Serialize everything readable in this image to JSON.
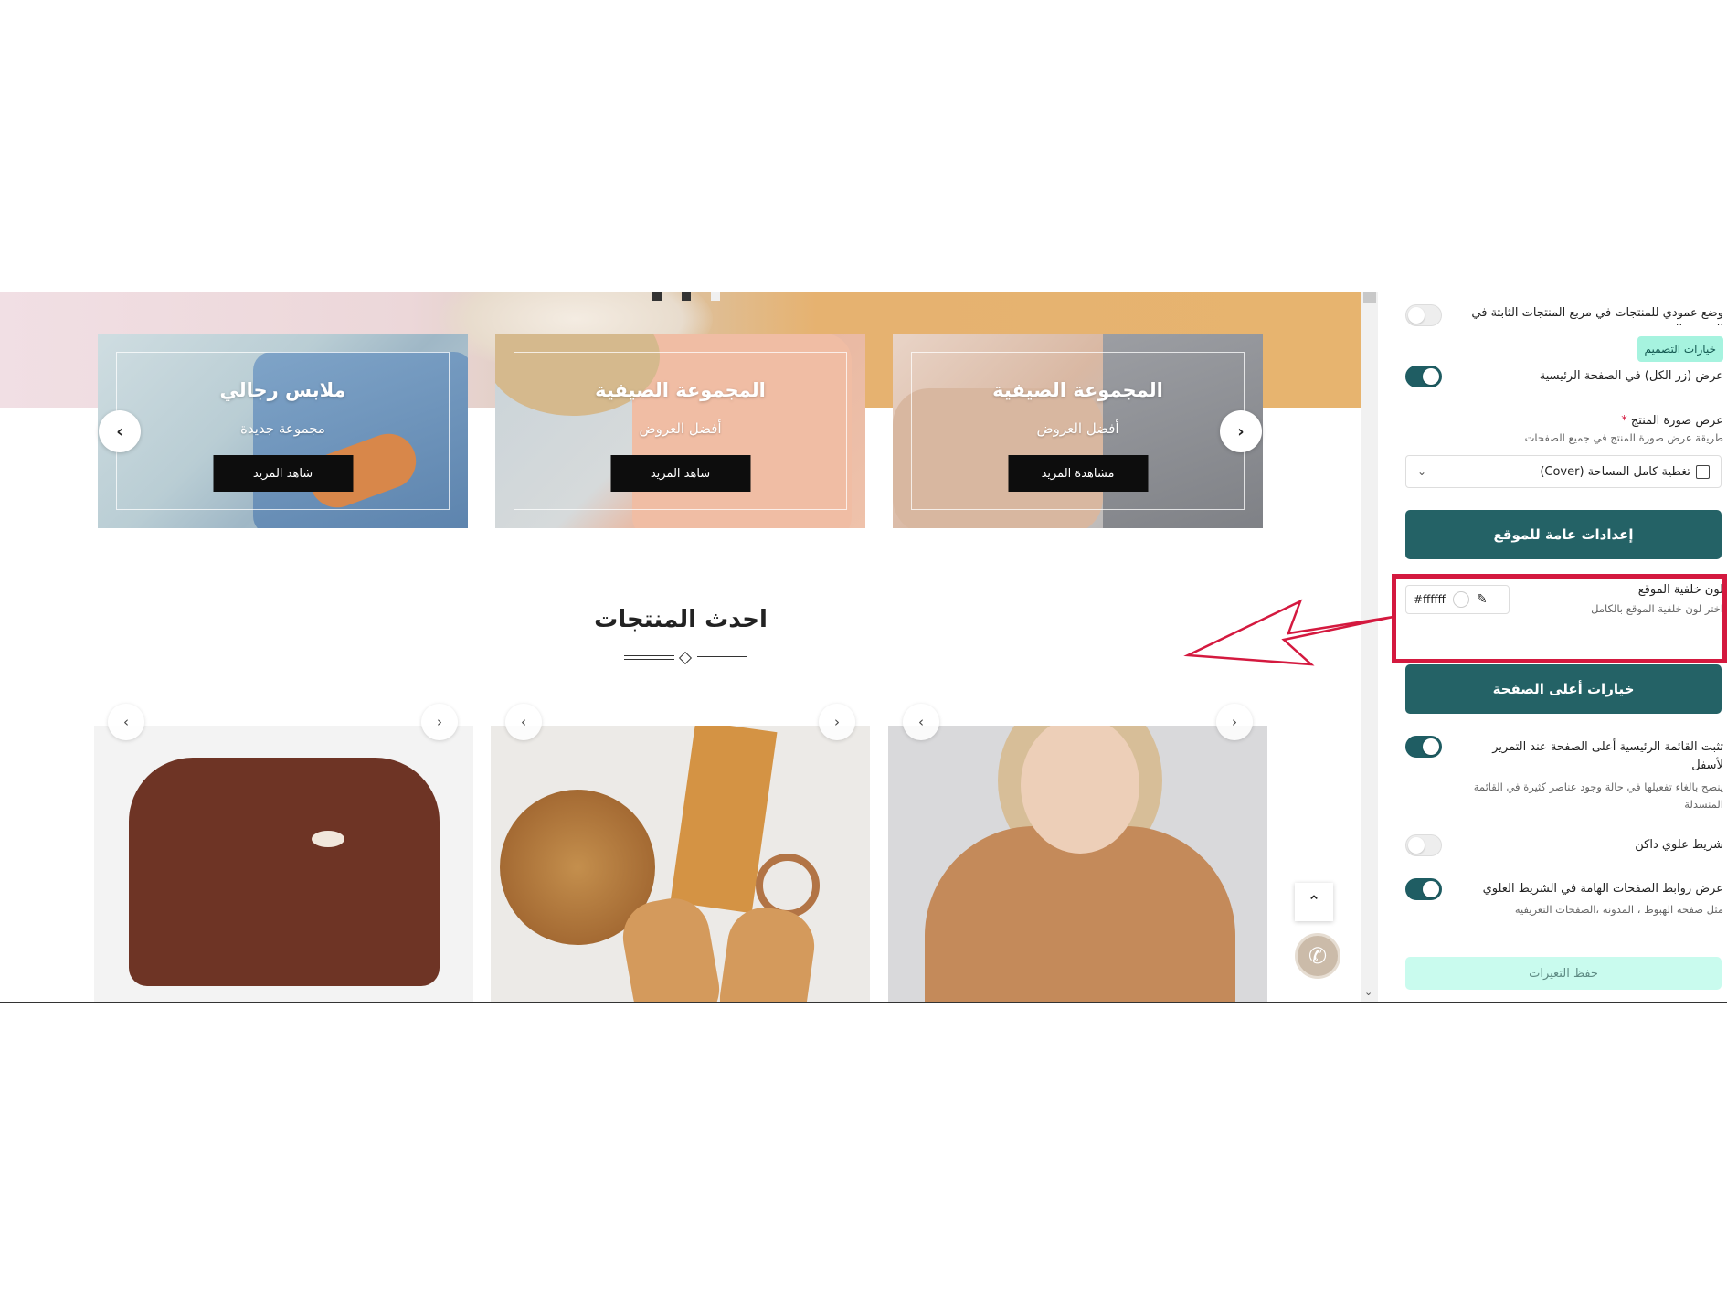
{
  "preview": {
    "banners": [
      {
        "title": "ملابس رجالي",
        "subtitle": "مجموعة جديدة",
        "button": "شاهد المزيد"
      },
      {
        "title": "المجموعة الصيفية",
        "subtitle": "أفضل العروض",
        "button": "شاهد المزيد"
      },
      {
        "title": "المجموعة الصيفية",
        "subtitle": "أفضل العروض",
        "button": "مشاهدة المزيد"
      }
    ],
    "section_title": "احدث المنتجات"
  },
  "panel": {
    "vertical_mode_label": "وضع عمودي للمنتجات في مربع المنتجات الثابتة في الصفحة الرئيسية",
    "design_options_chip": "خيارات التصميم",
    "show_all_button_label": "عرض (زر الكل) في الصفحة الرئيسية",
    "product_image_label": "عرض صورة المنتج",
    "required_mark": "*",
    "product_image_desc": "طريقة عرض صورة المنتج في جميع الصفحات",
    "product_image_value": "تغطية كامل المساحة (Cover)",
    "general_settings_button": "إعدادات عامة للموقع",
    "bg_color_label": "لون خلفية الموقع",
    "bg_color_desc": "اختر لون خلفية الموقع بالكامل",
    "bg_color_value": "#ffffff",
    "header_options_button": "خيارات أعلى الصفحة",
    "sticky_menu_label": "تثبت القائمة الرئيسية أعلى الصفحة عند التمرير لأسفل",
    "sticky_menu_desc": "ينصح بالغاء تفعيلها في حالة وجود عناصر كثيرة في القائمة المنسدلة",
    "dark_topbar_label": "شريط علوي داكن",
    "important_links_label": "عرض روابط الصفحات الهامة في الشريط العلوي",
    "important_links_desc": "مثل صفحة الهبوط ، المدونة ،الصفحات التعريفية",
    "save_button": "حفظ التغيرات"
  },
  "colors": {
    "accent": "#246266",
    "highlight": "#d4193f",
    "save_bg": "#c9fbee"
  }
}
